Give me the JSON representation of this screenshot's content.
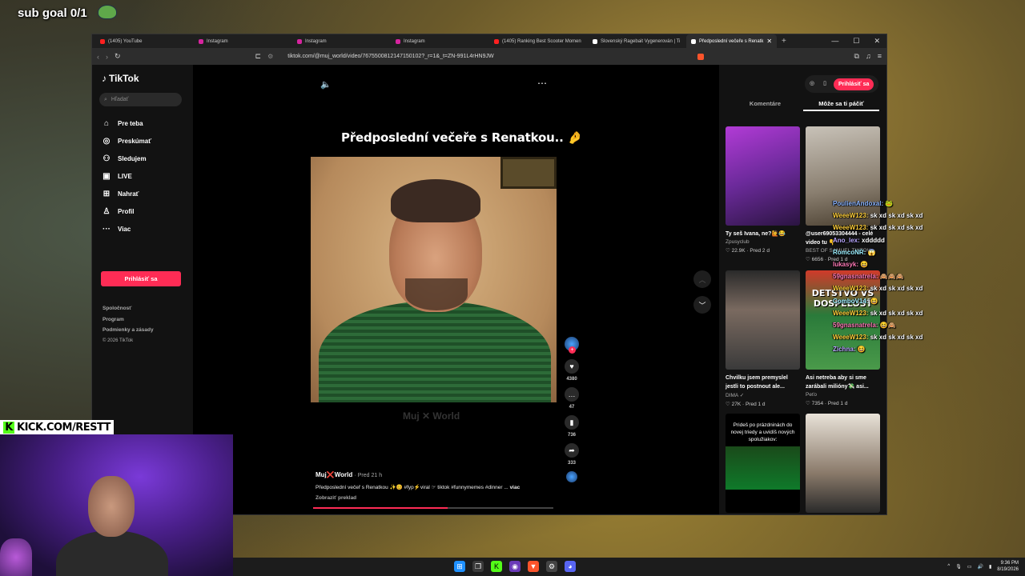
{
  "overlay": {
    "sub_goal": "sub goal 0/1",
    "kick_url": "KICK.COM/RESTT"
  },
  "browser": {
    "tabs": [
      {
        "label": "(1405) YouTube",
        "favicon": "youtube-icon",
        "active": false
      },
      {
        "label": "Instagram",
        "favicon": "instagram-icon",
        "active": false
      },
      {
        "label": "Instagram",
        "favicon": "instagram-icon",
        "active": false
      },
      {
        "label": "Instagram",
        "favicon": "instagram-icon",
        "active": false
      },
      {
        "label": "(1405) Ranking Best Scooter Momen",
        "favicon": "youtube-icon",
        "active": false
      },
      {
        "label": "Slovenský Ragebait Vygenerován | Ti",
        "favicon": "tiktok-icon",
        "active": false
      },
      {
        "label": "Předposlední večeře s Renatk",
        "favicon": "tiktok-icon",
        "active": true
      }
    ],
    "url": "tiktok.com/@muj_world/video/7675500812147150102?_r=1&_t=ZN-991L4rHN9JW"
  },
  "tiktok": {
    "logo": "TikTok",
    "search_placeholder": "Hľadať",
    "nav": [
      {
        "label": "Pre teba",
        "icon": "home-icon"
      },
      {
        "label": "Preskúmať",
        "icon": "compass-icon"
      },
      {
        "label": "Sledujem",
        "icon": "following-icon"
      },
      {
        "label": "LIVE",
        "icon": "live-icon"
      },
      {
        "label": "Nahrať",
        "icon": "upload-icon"
      },
      {
        "label": "Profil",
        "icon": "profile-icon"
      },
      {
        "label": "Viac",
        "icon": "more-icon"
      }
    ],
    "login_button": "Prihlásiť sa",
    "footer": [
      "Spoločnosť",
      "Program",
      "Podmienky a zásady"
    ],
    "copyright": "© 2026 TikTok"
  },
  "video": {
    "title": "Předposlední večeře s Renatkou.. 🤌",
    "watermark": "Muj ✕ World",
    "likes": "4380",
    "comments": "47",
    "saves": "736",
    "shares": "333",
    "author": "Muj❌World",
    "time": "· Pred 21 h",
    "caption": "Předposlední večeř s Renatkou ✨😊 #fyp⚡viral ☞ tiktok #funnymemes #dinner ...",
    "caption_more": "viac",
    "translate": "Zobraziť preklad",
    "progress": 0.56
  },
  "right_panel": {
    "login": "Prihlásiť sa",
    "tabs": [
      {
        "label": "Komentáre",
        "active": false
      },
      {
        "label": "Môže sa ti páčiť",
        "active": true
      }
    ],
    "cards": [
      {
        "title": "Ty seš Ivana, ne?🙋😂",
        "author": "Zpusyclub",
        "meta": "♡ 22.9K · Pred 2 d"
      },
      {
        "title": "@user69053304444 - celé video tu 👇",
        "author": "BEST OF SAMUEL TIKTOK",
        "meta": "♡ 6656 · Pred 1 d"
      },
      {
        "title": "Chvilku jsem premyslel jestli to postnout ale...",
        "author": "DIMA ✓",
        "meta": "♡ 27K · Pred 1 d"
      },
      {
        "title": "Asi netreba aby si sme zarábali milióny💸 asi...",
        "author": "Peťo",
        "meta": "♡ 7354 · Pred 1 d"
      },
      {
        "title": "",
        "author": "",
        "meta": ""
      },
      {
        "title": "",
        "author": "",
        "meta": ""
      }
    ],
    "card4_overlay": "DETSTVO VS DOSPELOSŤ",
    "card5_overlay": "Prideš po prázdninách do novej triedy a uvidíš nových spolužiakov:"
  },
  "chat": [
    {
      "name": "PoulienAndoxal:",
      "msg": "🐸"
    },
    {
      "name": "WeeeW123:",
      "msg": "sk xd sk xd sk xd"
    },
    {
      "name": "WeeeW123:",
      "msg": "sk xd sk xd sk xd"
    },
    {
      "name": "Ano_lex:",
      "msg": "xddddd"
    },
    {
      "name": "RomcoNR:",
      "msg": "😱"
    },
    {
      "name": "lukasyk:",
      "msg": "😆"
    },
    {
      "name": "59gnasnatrela:",
      "msg": "🙈🙈🙈"
    },
    {
      "name": "WeeeW123:",
      "msg": "sk xd sk xd sk xd"
    },
    {
      "name": "ComboV14:",
      "msg": "😆"
    },
    {
      "name": "WeeeW123:",
      "msg": "sk xd sk xd sk xd"
    },
    {
      "name": "59gnasnatrela:",
      "msg": "😆🙈"
    },
    {
      "name": "WeeeW123:",
      "msg": "sk xd sk xd sk xd"
    },
    {
      "name": "Zichna:",
      "msg": "😆"
    }
  ],
  "taskbar": {
    "time": "9:36 PM",
    "date": "8/19/2026"
  },
  "colors": {
    "tiktok_red": "#fe2c55",
    "kick_green": "#53fc18"
  }
}
